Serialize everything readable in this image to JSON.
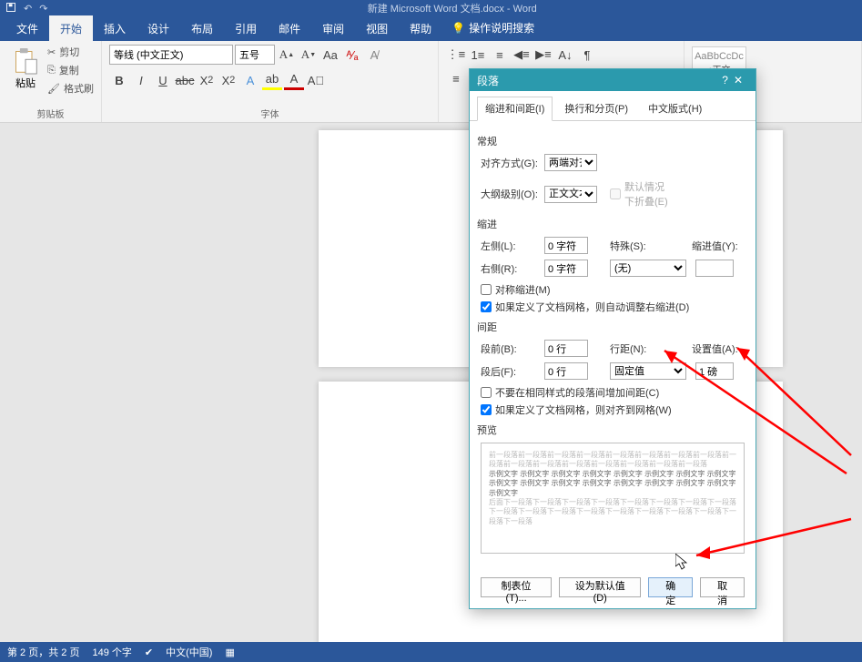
{
  "titlebar": {
    "title": "新建 Microsoft Word 文档.docx - Word"
  },
  "tabs": {
    "file": "文件",
    "home": "开始",
    "insert": "插入",
    "design": "设计",
    "layout": "布局",
    "references": "引用",
    "mailings": "邮件",
    "review": "审阅",
    "view": "视图",
    "help": "帮助",
    "tellme": "操作说明搜索"
  },
  "ribbon": {
    "clipboard": {
      "paste": "粘贴",
      "cut": "剪切",
      "copy": "复制",
      "formatpainter": "格式刷",
      "label": "剪贴板"
    },
    "font": {
      "name": "等线 (中文正文)",
      "size": "五号",
      "label": "字体"
    },
    "styles": {
      "normal_preview": "AaBbCcDc",
      "normal_label": "↓正文"
    }
  },
  "dialog": {
    "title": "段落",
    "tabs": {
      "indent": "缩进和间距(I)",
      "page": "换行和分页(P)",
      "chinese": "中文版式(H)"
    },
    "general": {
      "heading": "常规",
      "align_label": "对齐方式(G):",
      "align_value": "两端对齐",
      "outline_label": "大纲级别(O):",
      "outline_value": "正文文本",
      "collapsed": "默认情况下折叠(E)"
    },
    "indent": {
      "heading": "缩进",
      "left_label": "左侧(L):",
      "left_value": "0 字符",
      "right_label": "右侧(R):",
      "right_value": "0 字符",
      "special_label": "特殊(S):",
      "special_value": "(无)",
      "by_label": "缩进值(Y):",
      "mirror": "对称缩进(M)",
      "autogrid": "如果定义了文档网格，则自动调整右缩进(D)"
    },
    "spacing": {
      "heading": "间距",
      "before_label": "段前(B):",
      "before_value": "0 行",
      "after_label": "段后(F):",
      "after_value": "0 行",
      "line_label": "行距(N):",
      "line_value": "固定值",
      "at_label": "设置值(A):",
      "at_value": "1 磅",
      "noaddsame": "不要在相同样式的段落间增加间距(C)",
      "snapgrid": "如果定义了文档网格，则对齐到网格(W)"
    },
    "preview": {
      "heading": "预览",
      "gray1": "前一段落前一段落前一段落前一段落前一段落前一段落前一段落前一段落前一段落前一段落前一段落前一段落前一段落前一段落前一段落前一段落",
      "sample": "示例文字 示例文字 示例文字 示例文字 示例文字 示例文字 示例文字 示例文字 示例文字 示例文字 示例文字 示例文字 示例文字 示例文字 示例文字 示例文字 示例文字",
      "gray2": "后面下一段落下一段落下一段落下一段落下一段落下一段落下一段落下一段落下一段落下一段落下一段落下一段落下一段落下一段落下一段落下一段落下一段落下一段落"
    },
    "buttons": {
      "tabs": "制表位(T)...",
      "setdefault": "设为默认值(D)",
      "ok": "确定",
      "cancel": "取消"
    }
  },
  "statusbar": {
    "page": "第 2 页，共 2 页",
    "words": "149 个字",
    "lang": "中文(中国)"
  }
}
